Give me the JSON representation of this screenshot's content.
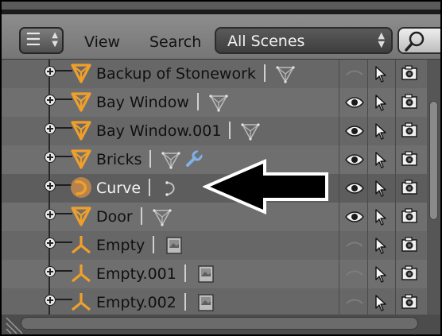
{
  "header": {
    "editor_type_icon": "outliner-icon",
    "menus": [
      "View",
      "Search"
    ],
    "display_mode": "All Scenes",
    "search_icon": "magnifier-icon"
  },
  "rows": [
    {
      "name": "Backup of Stonework",
      "object_type": "mesh",
      "data_icon": "mesh-data-icon",
      "visible": false,
      "selectable": true,
      "renderable": true,
      "selected": false
    },
    {
      "name": "Bay Window",
      "object_type": "mesh",
      "data_icon": "mesh-data-icon",
      "visible": true,
      "selectable": true,
      "renderable": true,
      "selected": false
    },
    {
      "name": "Bay Window.001",
      "object_type": "mesh",
      "data_icon": "mesh-data-icon",
      "visible": true,
      "selectable": true,
      "renderable": true,
      "selected": false
    },
    {
      "name": "Bricks",
      "object_type": "mesh",
      "data_icon": "mesh-data-icon",
      "modifier_icon": "wrench-icon",
      "visible": true,
      "selectable": true,
      "renderable": true,
      "selected": false
    },
    {
      "name": "Curve",
      "object_type": "curve",
      "data_icon": "curve-data-icon",
      "visible": true,
      "selectable": true,
      "renderable": true,
      "selected": true
    },
    {
      "name": "Door",
      "object_type": "mesh",
      "data_icon": "mesh-data-icon",
      "visible": true,
      "selectable": true,
      "renderable": true,
      "selected": false
    },
    {
      "name": "Empty",
      "object_type": "empty",
      "data_icon": "image-data-icon",
      "visible": false,
      "selectable": true,
      "renderable": true,
      "selected": false
    },
    {
      "name": "Empty.001",
      "object_type": "empty",
      "data_icon": "image-data-icon",
      "visible": false,
      "selectable": true,
      "renderable": true,
      "selected": false
    },
    {
      "name": "Empty.002",
      "object_type": "empty",
      "data_icon": "image-data-icon",
      "visible": false,
      "selectable": true,
      "renderable": true,
      "selected": false
    }
  ],
  "annotation": {
    "icon": "black-arrow-pointing-left"
  },
  "colors": {
    "mesh_orange": "#f0a02a",
    "selected_row": "#5d5d5d",
    "panel_bg": "#6f6f6f"
  }
}
